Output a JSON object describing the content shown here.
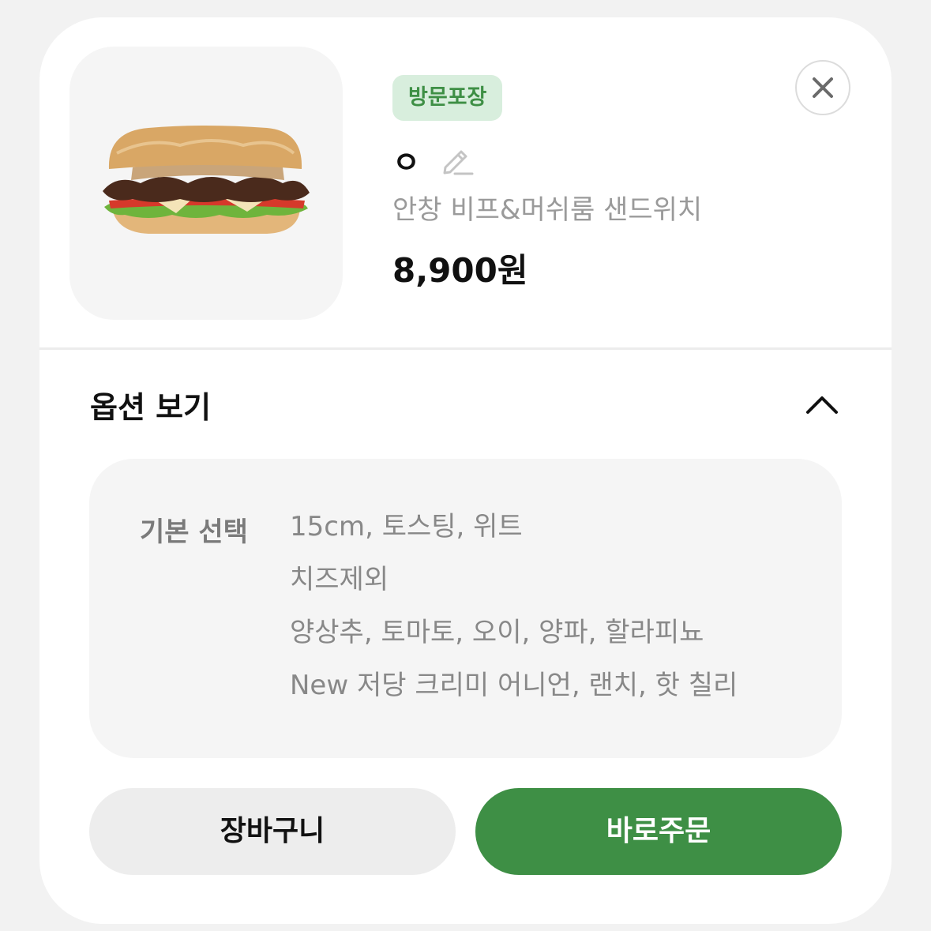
{
  "product": {
    "badge": "방문포장",
    "nickname": "ㅇ",
    "name": "안창 비프&머쉬룸 샌드위치",
    "price": "8,900원",
    "image": "sandwich-image"
  },
  "options": {
    "header": "옵션 보기",
    "label": "기본 선택",
    "lines": [
      "15cm, 토스팅, 위트",
      "치즈제외",
      "양상추, 토마토, 오이, 양파, 할라피뇨",
      "New 저당 크리미 어니언, 랜치, 핫 칠리"
    ]
  },
  "actions": {
    "cart_label": "장바구니",
    "order_label": "바로주문"
  },
  "icons": {
    "close": "close-icon",
    "edit": "pencil-icon",
    "collapse": "chevron-up-icon"
  },
  "colors": {
    "accent": "#3e8f45",
    "badge_bg": "#d8eedd",
    "muted_text": "#9a9a9a"
  }
}
